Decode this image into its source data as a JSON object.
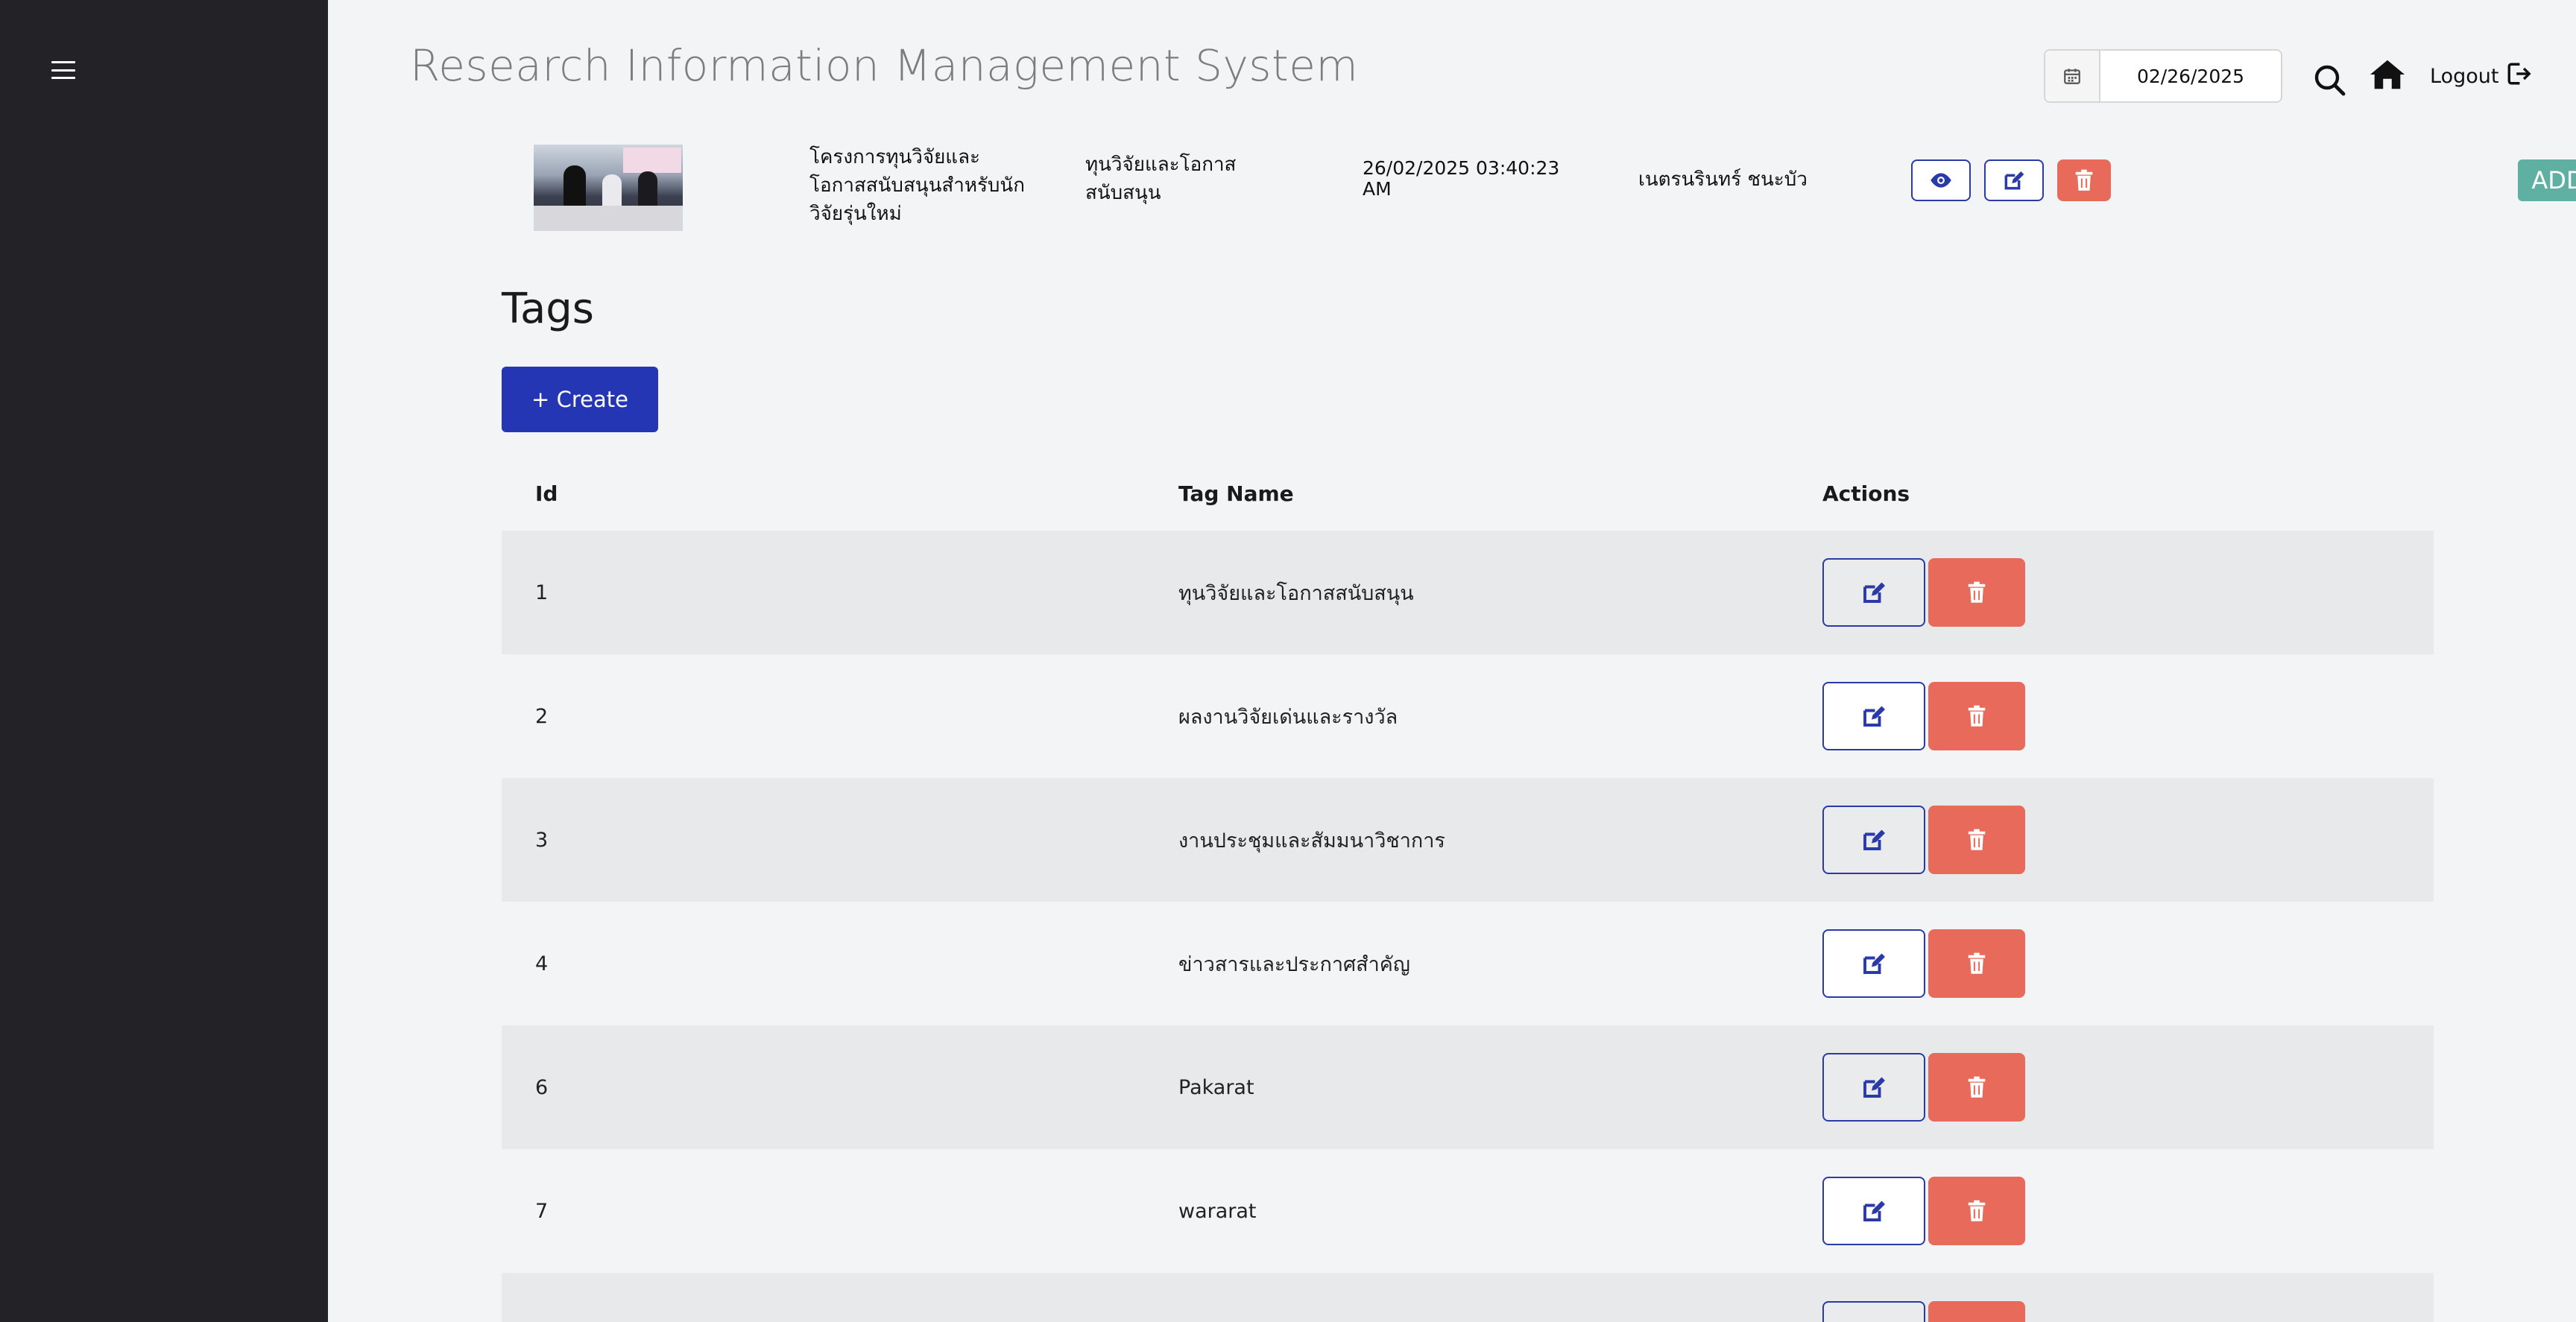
{
  "app": {
    "title": "Research Information Management System"
  },
  "header": {
    "date_value": "02/26/2025",
    "logout_label": "Logout"
  },
  "post": {
    "title": "โครงการทุนวิจัยและโอกาสสนับสนุนสำหรับนักวิจัยรุ่นใหม่",
    "category": "ทุนวิจัยและโอกาสสนับสนุน",
    "date": "26/02/2025 03:40:23 AM",
    "author": "เนตรนรินทร์ ชนะบัว",
    "add_label": "ADD"
  },
  "tags": {
    "section_title": "Tags",
    "create_label": "+ Create",
    "columns": [
      "Id",
      "Tag Name",
      "Actions"
    ],
    "rows": [
      {
        "id": "1",
        "name": "ทุนวิจัยและโอกาสสนับสนุน"
      },
      {
        "id": "2",
        "name": "ผลงานวิจัยเด่นและรางวัล"
      },
      {
        "id": "3",
        "name": "งานประชุมและสัมมนาวิชาการ"
      },
      {
        "id": "4",
        "name": "ข่าวสารและประกาศสำคัญ"
      },
      {
        "id": "6",
        "name": "Pakarat"
      },
      {
        "id": "7",
        "name": "wararat"
      }
    ]
  },
  "colors": {
    "sidebar": "#232226",
    "primary": "#2536b4",
    "danger": "#e76a5a",
    "success": "#5fb0a2"
  }
}
